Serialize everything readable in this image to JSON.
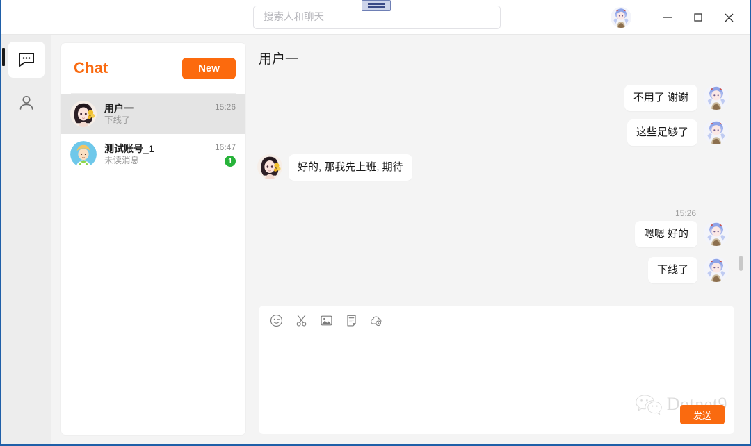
{
  "window": {
    "accent_orange": "#fa6a0f",
    "border_blue": "#1f5fa8",
    "drag_handle_name": "window-drag-handle"
  },
  "titlebar": {
    "search": {
      "placeholder": "搜索人和聊天",
      "value": ""
    },
    "controls": {
      "minimize": "−",
      "maximize": "□",
      "close": "✕"
    },
    "avatar_alt": "ganyu-avatar"
  },
  "rail": {
    "items": [
      {
        "name": "chat",
        "icon": "chat-bubble-icon",
        "active": true
      },
      {
        "name": "contacts",
        "icon": "person-icon",
        "active": false
      }
    ]
  },
  "list_panel": {
    "title": "Chat",
    "new_button": "New",
    "rows": [
      {
        "name": "用户一",
        "preview": "下线了",
        "time": "15:26",
        "badge": "",
        "selected": true,
        "avatar": "female-anime-avatar"
      },
      {
        "name": "测试账号_1",
        "preview": "未读消息",
        "time": "16:47",
        "badge": "1",
        "selected": false,
        "avatar": "cartoon-boy-avatar"
      }
    ]
  },
  "conversation": {
    "title": "用户一",
    "messages": [
      {
        "dir": "out",
        "text": "不用了 谢谢",
        "time": "",
        "avatar": "ganyu-avatar"
      },
      {
        "dir": "out",
        "text": "这些足够了",
        "time": "",
        "avatar": "ganyu-avatar"
      },
      {
        "dir": "in",
        "text": "好的, 那我先上班, 期待",
        "time": "",
        "avatar": "female-anime-avatar"
      },
      {
        "dir": "out",
        "text": "嗯嗯 好的",
        "time": "15:26",
        "avatar": "ganyu-avatar"
      },
      {
        "dir": "out",
        "text": "下线了",
        "time": "",
        "avatar": "ganyu-avatar"
      }
    ]
  },
  "composer": {
    "tools": [
      "emoji-icon",
      "scissors-icon",
      "image-icon",
      "file-icon",
      "cloud-history-icon"
    ],
    "input_value": "",
    "input_placeholder": "",
    "send_label": "发送"
  },
  "watermark": {
    "text": "Dotnet9",
    "logo": "wechat-logo-icon"
  }
}
